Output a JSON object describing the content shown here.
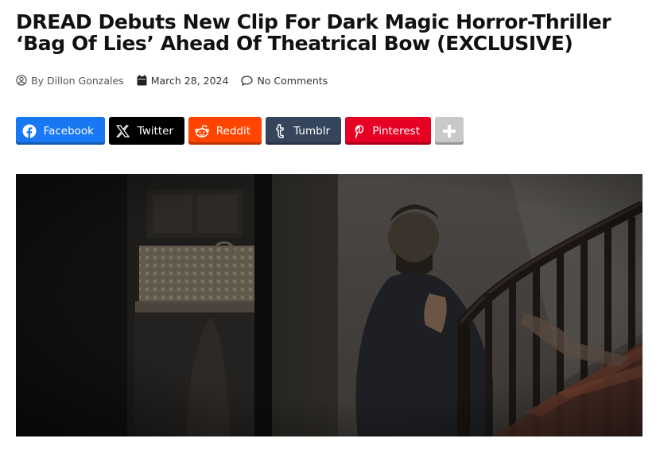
{
  "article": {
    "title": "DREAD Debuts New Clip For Dark Magic Horror-Thriller ‘Bag Of Lies’ Ahead Of Theatrical Bow (EXCLUSIVE)"
  },
  "meta": {
    "author": "By Dillon Gonzales",
    "date": "March 28, 2024",
    "comments": "No Comments",
    "icons": [
      "user-circle-icon",
      "calendar-icon",
      "comment-icon"
    ]
  },
  "share": {
    "facebook": "Facebook",
    "twitter": "Twitter",
    "reddit": "Reddit",
    "tumblr": "Tumblr",
    "pinterest": "Pinterest",
    "colors": {
      "facebook": "#1877f2",
      "twitter": "#000000",
      "reddit": "#ff4500",
      "tumblr": "#35465c",
      "pinterest": "#e60023",
      "more": "#c9c9c9"
    }
  }
}
